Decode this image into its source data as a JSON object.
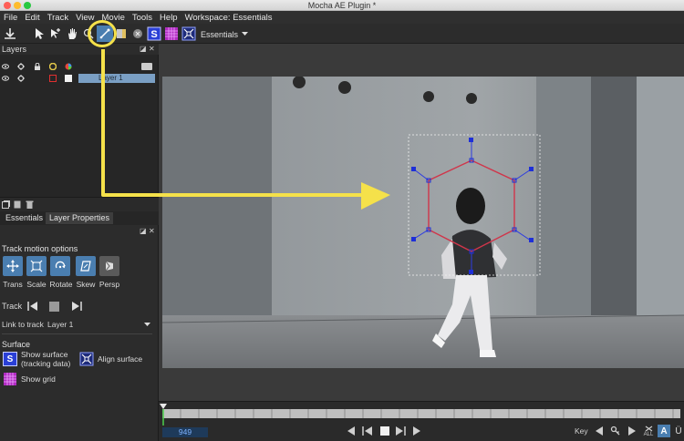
{
  "window": {
    "title": "Mocha AE Plugin *"
  },
  "menu": [
    "File",
    "Edit",
    "Track",
    "View",
    "Movie",
    "Tools",
    "Help",
    "Workspace: Essentials"
  ],
  "toolbar": {
    "workspace_dropdown": "Essentials"
  },
  "layers_panel": {
    "title": "Layers",
    "layer_name": "Layer 1"
  },
  "properties_panel": {
    "tabs": [
      "Essentials",
      "Layer Properties"
    ],
    "active_tab": "Layer Properties",
    "track_motion_label": "Track motion options",
    "motion_options": [
      "Trans",
      "Scale",
      "Rotate",
      "Skew",
      "Persp"
    ],
    "track_label": "Track",
    "link_label": "Link to track",
    "link_value": "Layer 1",
    "surface_label": "Surface",
    "show_surface_line1": "Show surface",
    "show_surface_line2": "(tracking data)",
    "align_surface": "Align surface",
    "show_grid": "Show grid"
  },
  "timeline": {
    "frame": "949",
    "key_label": "Key",
    "all_label": "ALL"
  },
  "colors": {
    "accent_blue": "#4a7eb0",
    "callout_yellow": "#f5e14a",
    "spline_red": "#d0354a",
    "point_blue": "#1e2fd8"
  }
}
